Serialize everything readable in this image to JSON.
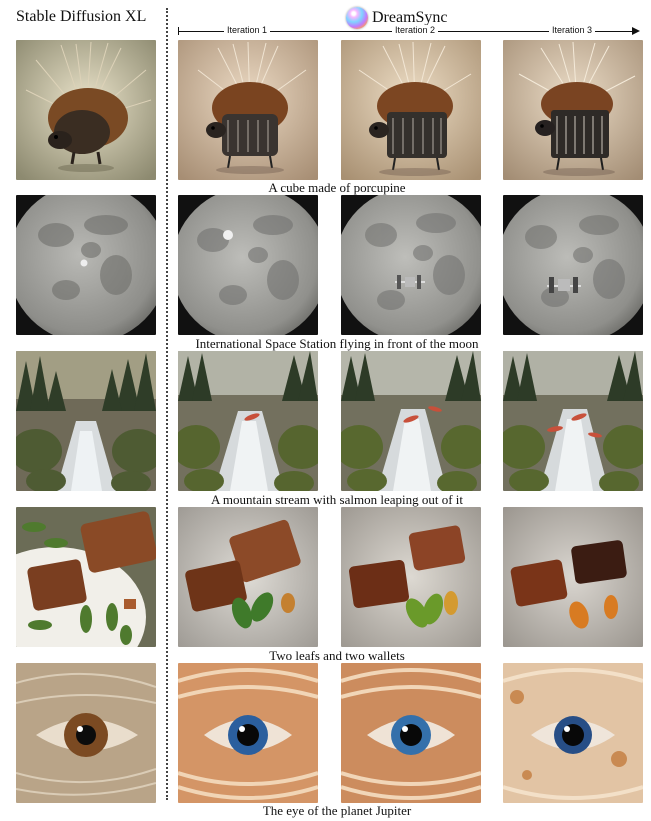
{
  "header": {
    "baseline_label": "Stable Diffusion XL",
    "method_label": "DreamSync",
    "iterations": [
      "Iteration 1",
      "Iteration 2",
      "Iteration 3"
    ]
  },
  "rows": [
    {
      "caption": "A cube made of porcupine"
    },
    {
      "caption": "International Space Station flying in front of the moon"
    },
    {
      "caption": "A mountain stream with salmon leaping out of it"
    },
    {
      "caption": "Two leafs and two wallets"
    },
    {
      "caption": "The eye of the planet Jupiter"
    }
  ]
}
